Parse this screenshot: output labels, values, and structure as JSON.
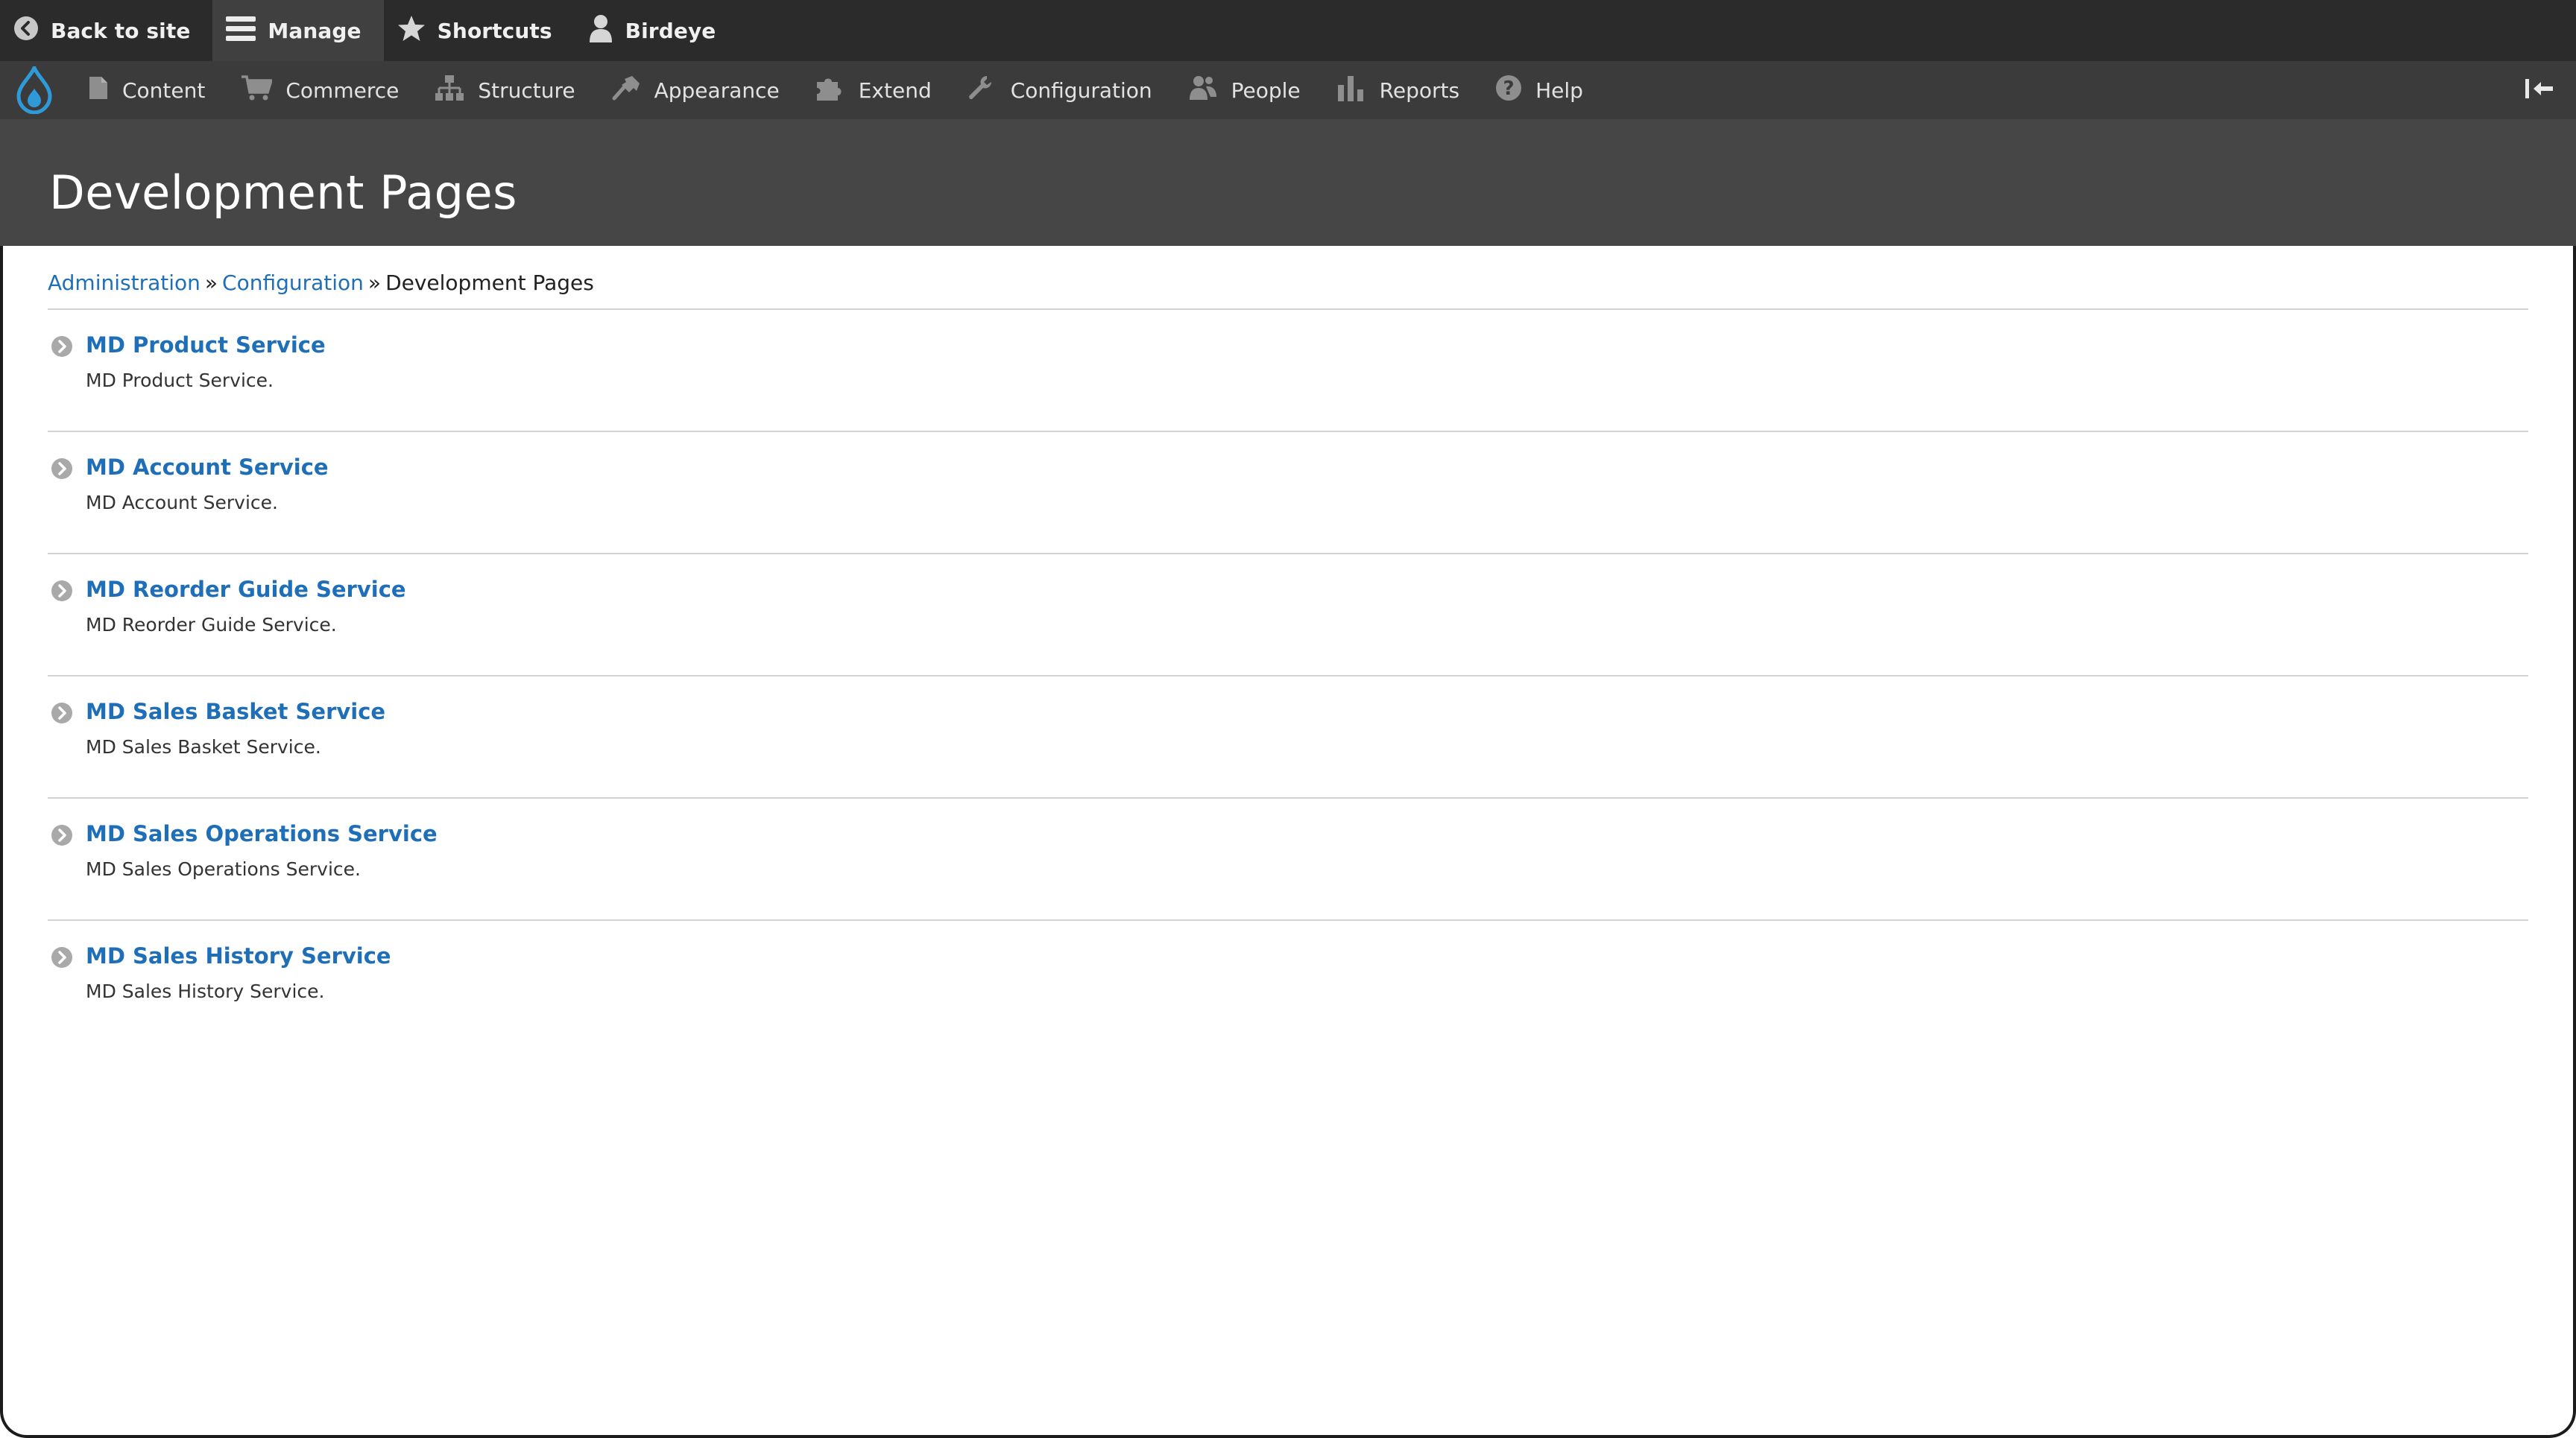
{
  "toolbar": {
    "items": [
      {
        "label": "Back to site",
        "icon": "back-arrow-icon"
      },
      {
        "label": "Manage",
        "icon": "hamburger-menu-icon"
      },
      {
        "label": "Shortcuts",
        "icon": "star-icon"
      },
      {
        "label": "Birdeye",
        "icon": "user-icon"
      }
    ]
  },
  "tray": {
    "logo": "drupal-drop-icon",
    "items": [
      {
        "label": "Content",
        "icon": "document-icon"
      },
      {
        "label": "Commerce",
        "icon": "cart-icon"
      },
      {
        "label": "Structure",
        "icon": "sitemap-icon"
      },
      {
        "label": "Appearance",
        "icon": "brush-icon"
      },
      {
        "label": "Extend",
        "icon": "puzzle-icon"
      },
      {
        "label": "Configuration",
        "icon": "wrench-icon"
      },
      {
        "label": "People",
        "icon": "people-icon"
      },
      {
        "label": "Reports",
        "icon": "bar-chart-icon"
      },
      {
        "label": "Help",
        "icon": "help-icon"
      }
    ],
    "toggle_icon": "collapse-left-icon"
  },
  "page": {
    "title": "Development Pages"
  },
  "breadcrumb": {
    "items": [
      {
        "label": "Administration",
        "link": true
      },
      {
        "label": "Configuration",
        "link": true
      },
      {
        "label": "Development Pages",
        "link": false
      }
    ],
    "separator": "»"
  },
  "entries": [
    {
      "title": "MD Product Service",
      "description": "MD Product Service."
    },
    {
      "title": "MD Account Service",
      "description": "MD Account Service."
    },
    {
      "title": "MD Reorder Guide Service",
      "description": "MD Reorder Guide Service."
    },
    {
      "title": "MD Sales Basket Service",
      "description": "MD Sales Basket Service."
    },
    {
      "title": "MD Sales Operations Service",
      "description": "MD Sales Operations Service."
    },
    {
      "title": "MD Sales History Service",
      "description": "MD Sales History Service."
    }
  ],
  "colors": {
    "toolbar_bg": "#2b2b2b",
    "tray_bg": "#3b3b3b",
    "header_bg": "#464646",
    "link": "#1f6fb8",
    "drupal_blue": "#2f9ad8"
  }
}
